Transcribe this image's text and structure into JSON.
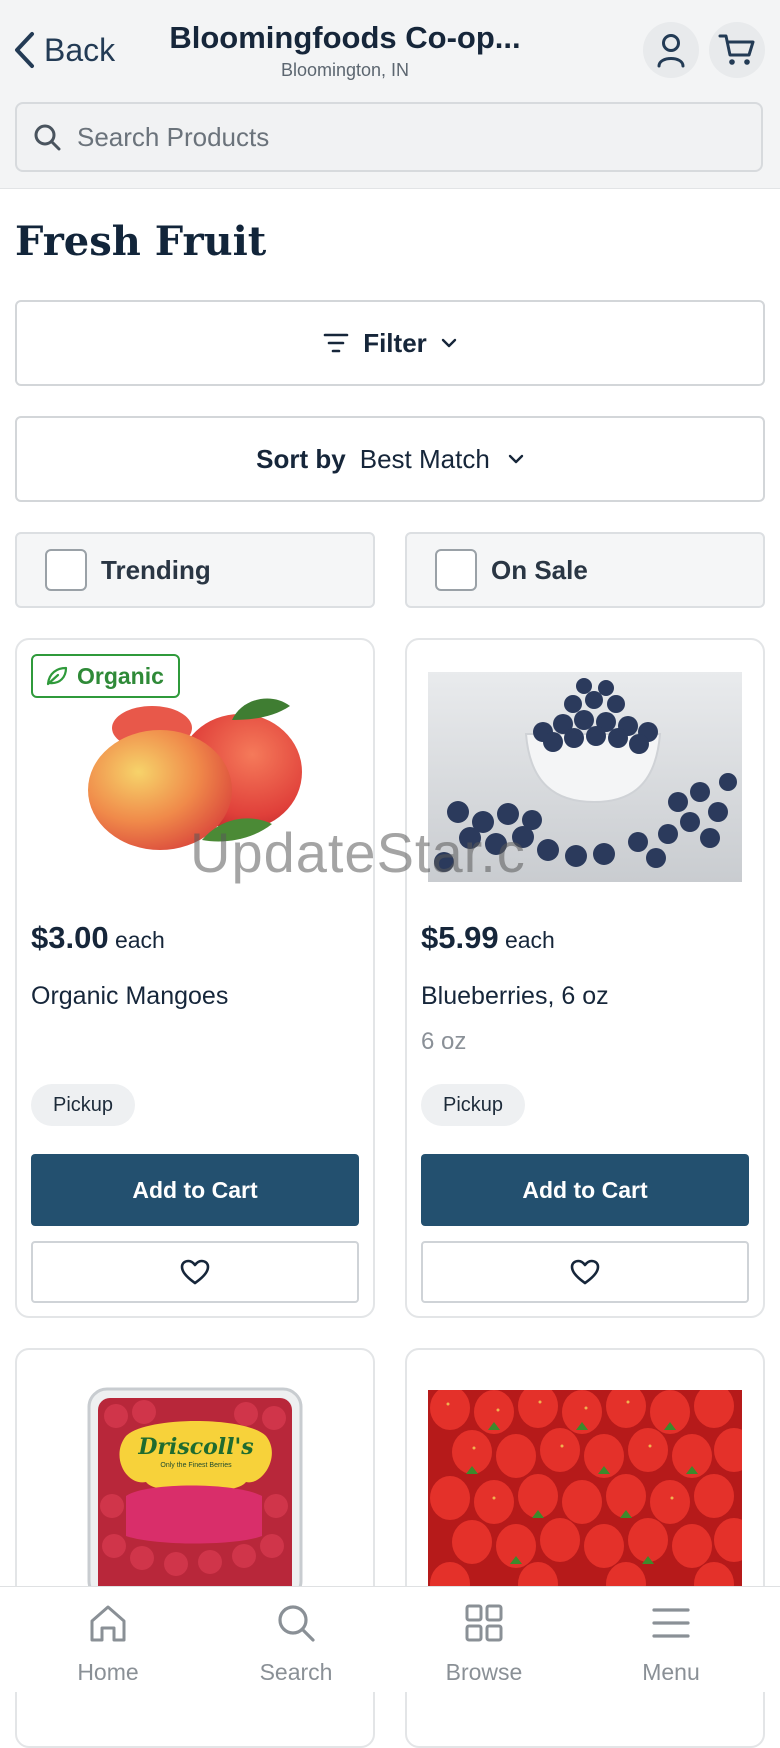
{
  "header": {
    "back_label": "Back",
    "store_name": "Bloomingfoods Co-op...",
    "store_location": "Bloomington, IN",
    "search_placeholder": "Search Products"
  },
  "page": {
    "title": "Fresh Fruit",
    "filter_label": "Filter",
    "sort_label": "Sort by",
    "sort_value": "Best Match"
  },
  "quick_filters": [
    {
      "label": "Trending",
      "checked": false
    },
    {
      "label": "On Sale",
      "checked": false
    }
  ],
  "products": [
    {
      "badge": "Organic",
      "price": "$3.00",
      "unit": "each",
      "name": "Organic Mangoes",
      "size": "",
      "fulfillment": "Pickup",
      "cta": "Add to Cart",
      "image": "mango-image"
    },
    {
      "badge": "",
      "price": "$5.99",
      "unit": "each",
      "name": "Blueberries, 6 oz",
      "size": "6 oz",
      "fulfillment": "Pickup",
      "cta": "Add to Cart",
      "image": "blueberries-image"
    },
    {
      "image": "raspberries-image",
      "package_text": "Driscoll's",
      "package_subtext": "Only the Finest Berries"
    },
    {
      "image": "strawberries-image"
    }
  ],
  "watermark": "UpdateStar.c",
  "nav": [
    {
      "label": "Home",
      "icon": "home-icon"
    },
    {
      "label": "Search",
      "icon": "search-icon"
    },
    {
      "label": "Browse",
      "icon": "grid-icon"
    },
    {
      "label": "Menu",
      "icon": "menu-icon"
    }
  ],
  "colors": {
    "primary": "#23506f",
    "organic": "#2f9a3b",
    "title": "#12253a"
  }
}
